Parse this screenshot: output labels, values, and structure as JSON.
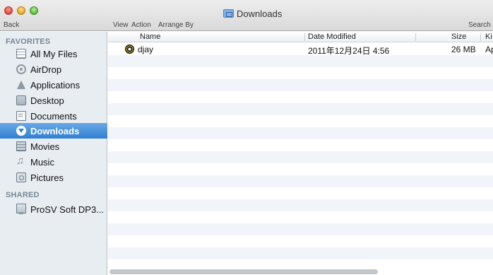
{
  "window": {
    "title": "Downloads",
    "buttons": [
      "close",
      "minimize",
      "zoom"
    ]
  },
  "toolbar": {
    "back_label": "Back",
    "view_label": "View",
    "action_label": "Action",
    "arrange_label": "Arrange By",
    "search_label": "Search"
  },
  "sidebar": {
    "favorites_heading": "FAVORITES",
    "shared_heading": "SHARED",
    "favorites": [
      {
        "label": "All My Files",
        "icon": "all-files-icon"
      },
      {
        "label": "AirDrop",
        "icon": "airdrop-icon"
      },
      {
        "label": "Applications",
        "icon": "applications-icon"
      },
      {
        "label": "Desktop",
        "icon": "desktop-icon"
      },
      {
        "label": "Documents",
        "icon": "documents-icon"
      },
      {
        "label": "Downloads",
        "icon": "downloads-icon",
        "selected": true
      },
      {
        "label": "Movies",
        "icon": "movies-icon"
      },
      {
        "label": "Music",
        "icon": "music-icon"
      },
      {
        "label": "Pictures",
        "icon": "pictures-icon"
      }
    ],
    "shared": [
      {
        "label": "ProSV Soft DP3...",
        "icon": "computer-icon"
      }
    ]
  },
  "list": {
    "columns": {
      "name": "Name",
      "date": "Date Modified",
      "size": "Size",
      "kind": "Ki"
    },
    "rows": [
      {
        "name": "djay",
        "date": "2011年12月24日 4:56",
        "size": "26 MB",
        "kind": "Ap",
        "icon": "djay-app-icon"
      }
    ]
  },
  "colors": {
    "selection": "#2f80d0",
    "sidebar_bg": "#e8edf2",
    "heading_text": "#788797"
  }
}
